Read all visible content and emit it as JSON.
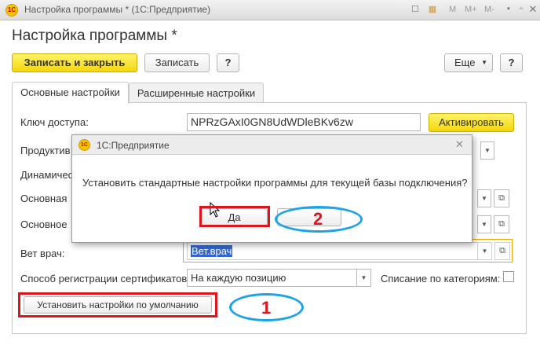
{
  "window": {
    "title": "Настройка программы * (1С:Предприятие)",
    "logo": "1С",
    "icons": [
      "bookmark-icon",
      "calendar-icon"
    ],
    "mem_buttons": [
      "M",
      "M+",
      "M-"
    ],
    "controls": [
      "minimize-icon",
      "maximize-icon",
      "close-icon"
    ]
  },
  "form": {
    "title": "Настройка программы *",
    "toolbar": {
      "save_close": "Записать и закрыть",
      "save": "Записать",
      "help": "?",
      "more": "Еще",
      "help2": "?"
    },
    "tabs": [
      {
        "label": "Основные настройки",
        "active": true
      },
      {
        "label": "Расширенные настройки",
        "active": false
      }
    ],
    "fields": {
      "access_key": {
        "label": "Ключ доступа:",
        "value": "NPRzGAxI0GN8UdWDleBKv6zw"
      },
      "activate_button": "Активировать",
      "productive": {
        "label": "Продуктив"
      },
      "dynamic": {
        "label": "Динамичес"
      },
      "main1": {
        "label": "Основная"
      },
      "main2": {
        "label": "Основное"
      },
      "vet": {
        "label": "Вет врач:",
        "value": "Вет.врач"
      },
      "cert_method": {
        "label": "Способ регистрации сертификатов:",
        "value": "На каждую позицию"
      },
      "write_off": {
        "label": "Списание по категориям:",
        "checked": false
      },
      "defaults_button": "Установить настройки по умолчанию"
    }
  },
  "dialog": {
    "title": "1С:Предприятие",
    "message": "Установить стандартные настройки программы для текущей базы подключения?",
    "yes": "Да"
  },
  "annotations": {
    "step1": "1",
    "step2": "2",
    "rect_color": "#e0141c",
    "ellipse_color": "#1aa3e8"
  },
  "colors": {
    "accent_yellow": "#f4d60b",
    "focus_orange": "#f0a500",
    "selection_blue": "#3366cc"
  }
}
